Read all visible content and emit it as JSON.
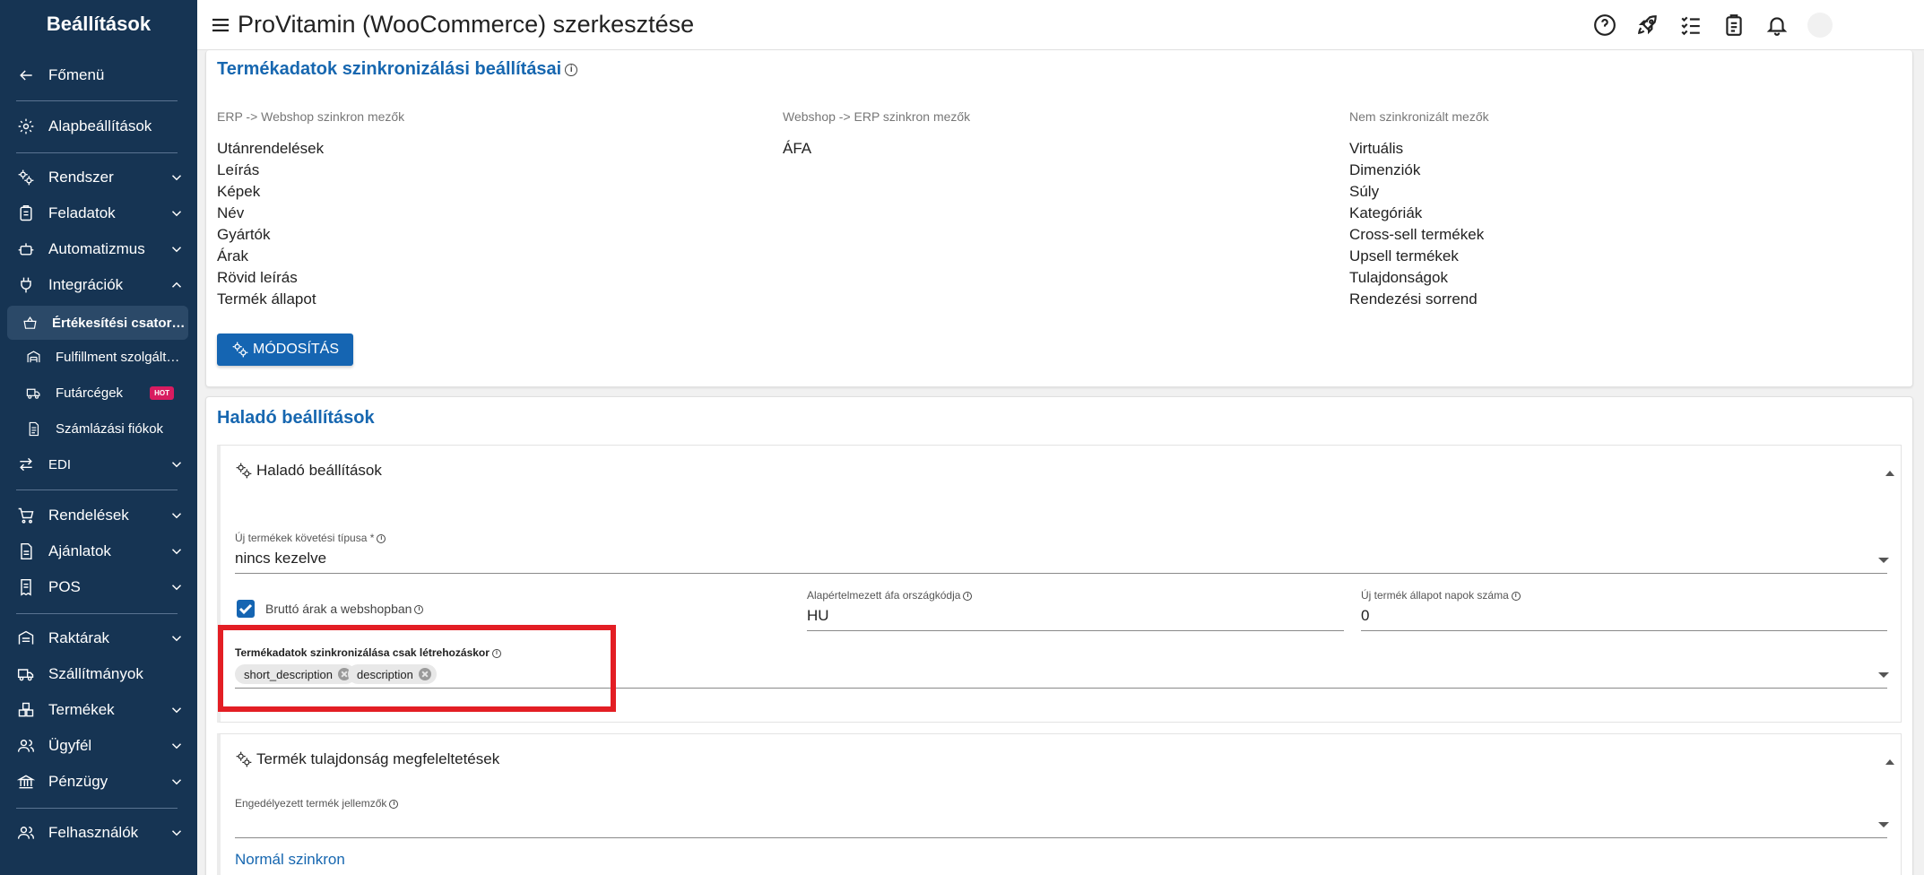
{
  "sidebar": {
    "title": "Beállítások",
    "items": [
      {
        "label": "Főmenü"
      },
      {
        "label": "Alapbeállítások"
      },
      {
        "label": "Rendszer"
      },
      {
        "label": "Feladatok"
      },
      {
        "label": "Automatizmus"
      },
      {
        "label": "Integrációk"
      },
      {
        "label": "Értékesítési csatornák"
      },
      {
        "label": "Fulfillment szolgáltatók"
      },
      {
        "label": "Futárcégek",
        "badge": "HOT"
      },
      {
        "label": "Számlázási fiókok"
      },
      {
        "label": "EDI"
      },
      {
        "label": "Rendelések"
      },
      {
        "label": "Ajánlatok"
      },
      {
        "label": "POS"
      },
      {
        "label": "Raktárak"
      },
      {
        "label": "Szállítmányok"
      },
      {
        "label": "Termékek"
      },
      {
        "label": "Ügyfél"
      },
      {
        "label": "Pénzügy"
      },
      {
        "label": "Felhasználók"
      }
    ]
  },
  "topbar": {
    "title": "ProVitamin (WooCommerce) szerkesztése",
    "icons": [
      "help-icon",
      "rocket-icon",
      "checklist-icon",
      "clipboard-icon",
      "bell-icon"
    ]
  },
  "sync": {
    "title": "Termékadatok szinkronizálási beállításai",
    "columns": [
      {
        "header": "ERP -> Webshop szinkron mezők",
        "items": [
          "Utánrendelések",
          "Leírás",
          "Képek",
          "Név",
          "Gyártók",
          "Árak",
          "Rövid leírás",
          "Termék állapot"
        ]
      },
      {
        "header": "Webshop -> ERP szinkron mezők",
        "items": [
          "ÁFA"
        ]
      },
      {
        "header": "Nem szinkronizált mezők",
        "items": [
          "Virtuális",
          "Dimenziók",
          "Súly",
          "Kategóriák",
          "Cross-sell termékek",
          "Upsell termékek",
          "Tulajdonságok",
          "Rendezési sorrend"
        ]
      }
    ],
    "modify_button": "MÓDOSÍTÁS"
  },
  "advanced": {
    "title": "Haladó beállítások",
    "panel_title": "Haladó beállítások",
    "new_product_label": "Új termékek követési típusa *",
    "new_product_value": "nincs kezelve",
    "gross_prices_label": "Bruttó árak a webshopban",
    "gross_prices_checked": true,
    "vat_country_label": "Alapértelmezett áfa országkódja",
    "vat_country_value": "HU",
    "new_state_days_label": "Új termék állapot napok száma",
    "new_state_days_value": "0",
    "sync_on_create_label": "Termékadatok szinkronizálása csak létrehozáskor",
    "sync_on_create_chips": [
      "short_description",
      "description"
    ]
  },
  "property": {
    "panel_title": "Termék tulajdonság megfeleltetések",
    "allowed_label": "Engedélyezett termék jellemzők",
    "normal_sync_link": "Normál szinkron"
  },
  "colors": {
    "sidebar_bg": "#163453",
    "accent": "#1565b2",
    "highlight": "#e31e24"
  }
}
